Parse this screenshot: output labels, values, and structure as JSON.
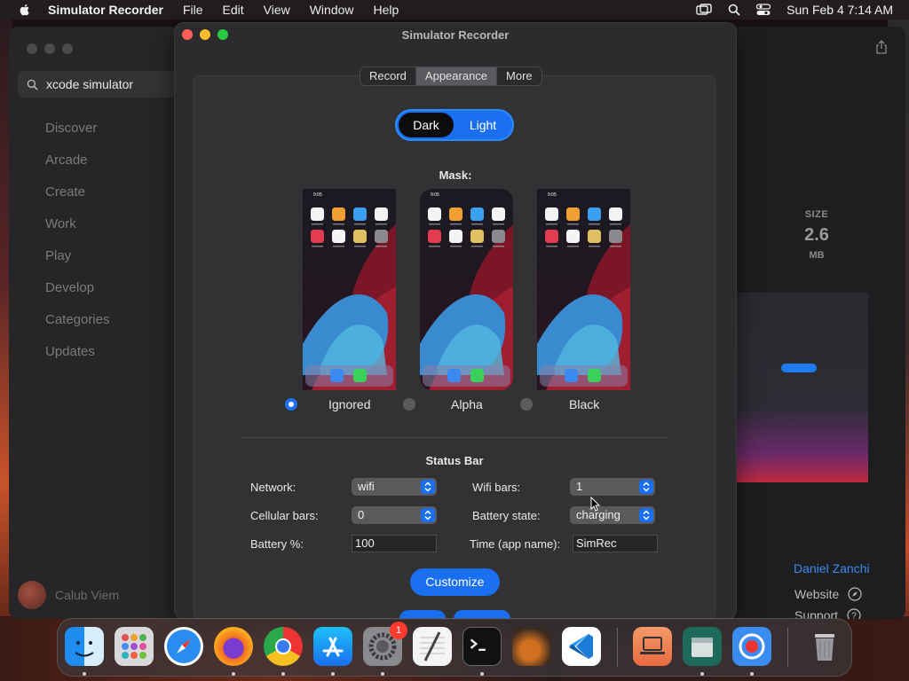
{
  "menubar": {
    "app_name": "Simulator Recorder",
    "menus": [
      "File",
      "Edit",
      "View",
      "Window",
      "Help"
    ],
    "clock": "Sun Feb 4  7:14 AM"
  },
  "store": {
    "search_value": "xcode simulator",
    "nav": [
      "Discover",
      "Arcade",
      "Create",
      "Work",
      "Play",
      "Develop",
      "Categories",
      "Updates"
    ],
    "user_name": "Calub Viem",
    "size_label": "SIZE",
    "size_value": "2.6",
    "size_unit": "MB",
    "developer": "Daniel Zanchi",
    "website": "Website",
    "support": "Support"
  },
  "window": {
    "title": "Simulator Recorder",
    "tabs": [
      "Record",
      "Appearance",
      "More"
    ],
    "active_tab": "Appearance",
    "theme": {
      "dark": "Dark",
      "light": "Light",
      "selected": "Dark"
    },
    "mask_label": "Mask:",
    "mask_options": [
      "Ignored",
      "Alpha",
      "Black"
    ],
    "mask_selected": "Ignored",
    "status_bar_title": "Status Bar",
    "fields": {
      "network_label": "Network:",
      "network_value": "wifi",
      "wifi_bars_label": "Wifi bars:",
      "wifi_bars_value": "1",
      "cellular_label": "Cellular bars:",
      "cellular_value": "0",
      "battery_state_label": "Battery state:",
      "battery_state_value": "charging",
      "battery_pct_label": "Battery %:",
      "battery_pct_value": "100",
      "time_label": "Time (app name):",
      "time_value": "SimRec"
    },
    "customize_label": "Customize",
    "phone_time": "9:05"
  },
  "dock": {
    "apps": [
      "Finder",
      "Launchpad",
      "Safari",
      "Firefox",
      "Chrome",
      "App Store",
      "System Settings",
      "TextEdit",
      "Terminal",
      "GarageBand",
      "Visual Studio Code",
      "Simulator Recorder",
      "Archive Utility",
      "Recorder",
      "Trash"
    ],
    "settings_badge": "1"
  },
  "colors": {
    "accent": "#1a6ff0",
    "window_bg": "#2c2c2e",
    "close": "#ff5f57",
    "minimize": "#febc2e",
    "zoom": "#28c840"
  }
}
